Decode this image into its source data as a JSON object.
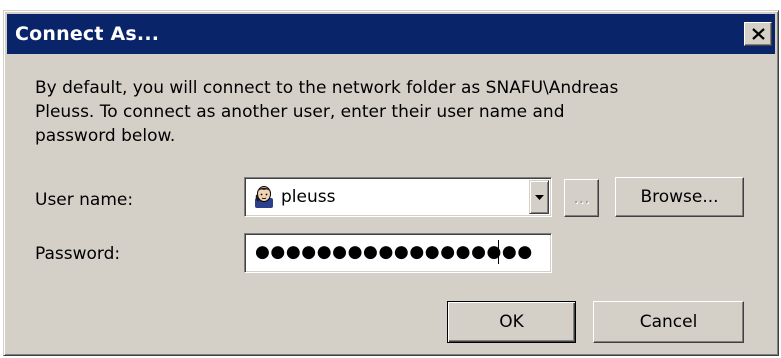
{
  "window": {
    "title": "Connect As...",
    "close_icon": "close-icon"
  },
  "description": "By default, you will connect to the network folder as SNAFU\\Andreas Pleuss. To connect as another user, enter their user name and password below.",
  "user_name": {
    "label": "User name:",
    "value": "pleuss",
    "icon": "user-icon"
  },
  "ellipsis_button": {
    "label": "...",
    "enabled": false
  },
  "browse_button": {
    "label": "Browse..."
  },
  "password": {
    "label": "Password:",
    "masked_value": "●●●●●●●●●●●●●●●●●●"
  },
  "ok_button": {
    "label": "OK"
  },
  "cancel_button": {
    "label": "Cancel"
  },
  "colors": {
    "titlebar": "#0a246a",
    "dialog_face": "#d4d0c8"
  }
}
